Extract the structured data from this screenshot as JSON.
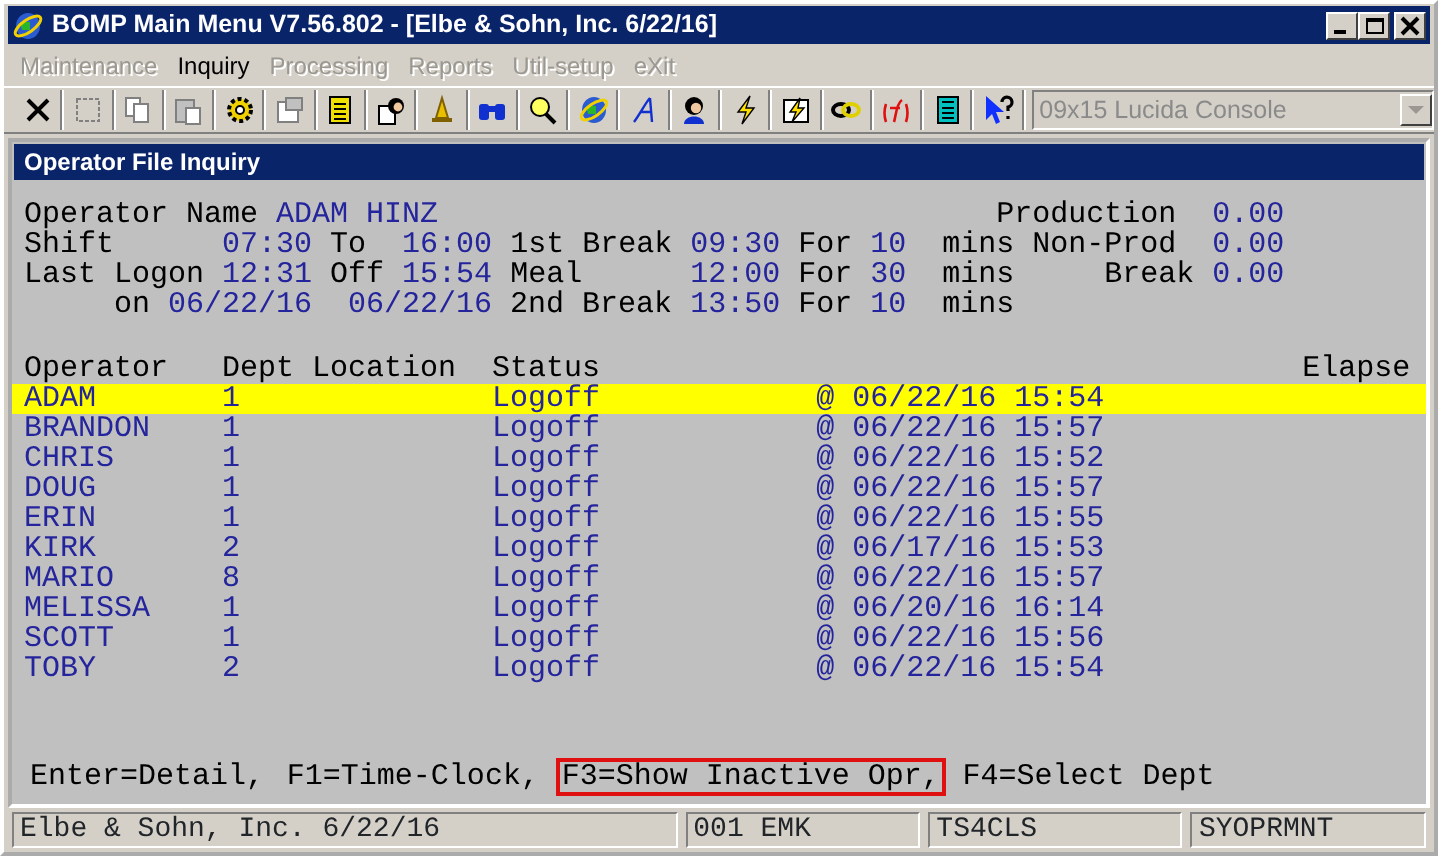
{
  "window": {
    "title": "BOMP Main Menu V7.56.802 - [Elbe & Sohn, Inc. 6/22/16]"
  },
  "menu": [
    {
      "label": "Maintenance",
      "disabled": true
    },
    {
      "label": "Inquiry",
      "disabled": false
    },
    {
      "label": "Processing",
      "disabled": true
    },
    {
      "label": "Reports",
      "disabled": true
    },
    {
      "label": "Util-setup",
      "disabled": true
    },
    {
      "label": "eXit",
      "disabled": true
    }
  ],
  "toolbar": {
    "font_select": {
      "value": "09x15 Lucida Console",
      "disabled": true
    }
  },
  "child_window": {
    "title": "Operator File Inquiry"
  },
  "summary": [
    [
      {
        "text": "Operator Name",
        "kind": "label"
      },
      {
        "text": "ADAM HINZ",
        "kind": "value"
      },
      {
        "text": "Production",
        "kind": "label"
      },
      {
        "text": "0.00",
        "kind": "value"
      }
    ],
    [
      {
        "text": "Shift",
        "kind": "label"
      },
      {
        "text": "07:30",
        "kind": "value"
      },
      {
        "text": "To",
        "kind": "label"
      },
      {
        "text": "16:00",
        "kind": "value"
      },
      {
        "text": "1st Break",
        "kind": "label"
      },
      {
        "text": "09:30",
        "kind": "value"
      },
      {
        "text": "For",
        "kind": "label"
      },
      {
        "text": "10",
        "kind": "value"
      },
      {
        "text": "mins",
        "kind": "label"
      },
      {
        "text": "Non-Prod",
        "kind": "label"
      },
      {
        "text": "0.00",
        "kind": "value"
      }
    ],
    [
      {
        "text": "Last Logon",
        "kind": "label"
      },
      {
        "text": "12:31",
        "kind": "value"
      },
      {
        "text": "Off",
        "kind": "label"
      },
      {
        "text": "15:54",
        "kind": "value"
      },
      {
        "text": "Meal",
        "kind": "label"
      },
      {
        "text": "12:00",
        "kind": "value"
      },
      {
        "text": "For",
        "kind": "label"
      },
      {
        "text": "30",
        "kind": "value"
      },
      {
        "text": "mins",
        "kind": "label"
      },
      {
        "text": "Break",
        "kind": "label"
      },
      {
        "text": "0.00",
        "kind": "value"
      }
    ],
    [
      {
        "text": "on",
        "kind": "label"
      },
      {
        "text": "06/22/16",
        "kind": "value"
      },
      {
        "text": "06/22/16",
        "kind": "value"
      },
      {
        "text": "2nd Break",
        "kind": "label"
      },
      {
        "text": "13:50",
        "kind": "value"
      },
      {
        "text": "For",
        "kind": "label"
      },
      {
        "text": "10",
        "kind": "value"
      },
      {
        "text": "mins",
        "kind": "label"
      }
    ]
  ],
  "table": {
    "columns": [
      "Operator",
      "Dept Location",
      "Status",
      "Elapse"
    ],
    "rows": [
      {
        "operator": "ADAM",
        "dept": "1",
        "status": "Logoff",
        "column_4": "@ 06/22/16 15:54",
        "selected": true
      },
      {
        "operator": "BRANDON",
        "dept": "1",
        "status": "Logoff",
        "column_4": "@ 06/22/16 15:57",
        "selected": false
      },
      {
        "operator": "CHRIS",
        "dept": "1",
        "status": "Logoff",
        "column_4": "@ 06/22/16 15:52",
        "selected": false
      },
      {
        "operator": "DOUG",
        "dept": "1",
        "status": "Logoff",
        "column_4": "@ 06/22/16 15:57",
        "selected": false
      },
      {
        "operator": "ERIN",
        "dept": "1",
        "status": "Logoff",
        "column_4": "@ 06/22/16 15:55",
        "selected": false
      },
      {
        "operator": "KIRK",
        "dept": "2",
        "status": "Logoff",
        "column_4": "@ 06/17/16 15:53",
        "selected": false
      },
      {
        "operator": "MARIO",
        "dept": "8",
        "status": "Logoff",
        "column_4": "@ 06/22/16 15:57",
        "selected": false
      },
      {
        "operator": "MELISSA",
        "dept": "1",
        "status": "Logoff",
        "column_4": "@ 06/20/16 16:14",
        "selected": false
      },
      {
        "operator": "SCOTT",
        "dept": "1",
        "status": "Logoff",
        "column_4": "@ 06/22/16 15:56",
        "selected": false
      },
      {
        "operator": "TOBY",
        "dept": "2",
        "status": "Logoff",
        "column_4": "@ 06/22/16 15:54",
        "selected": false
      }
    ]
  },
  "key_hints": [
    {
      "text": "Enter=Detail,",
      "highlighted": false
    },
    {
      "text": "F1=Time-Clock,",
      "highlighted": false
    },
    {
      "text": "F3=Show Inactive Opr,",
      "highlighted": true
    },
    {
      "text": "F4=Select Dept",
      "highlighted": false
    }
  ],
  "status_bar": [
    "Elbe & Sohn, Inc. 6/22/16",
    "001 EMK",
    "TS4CLS",
    "SYOPRMNT"
  ]
}
